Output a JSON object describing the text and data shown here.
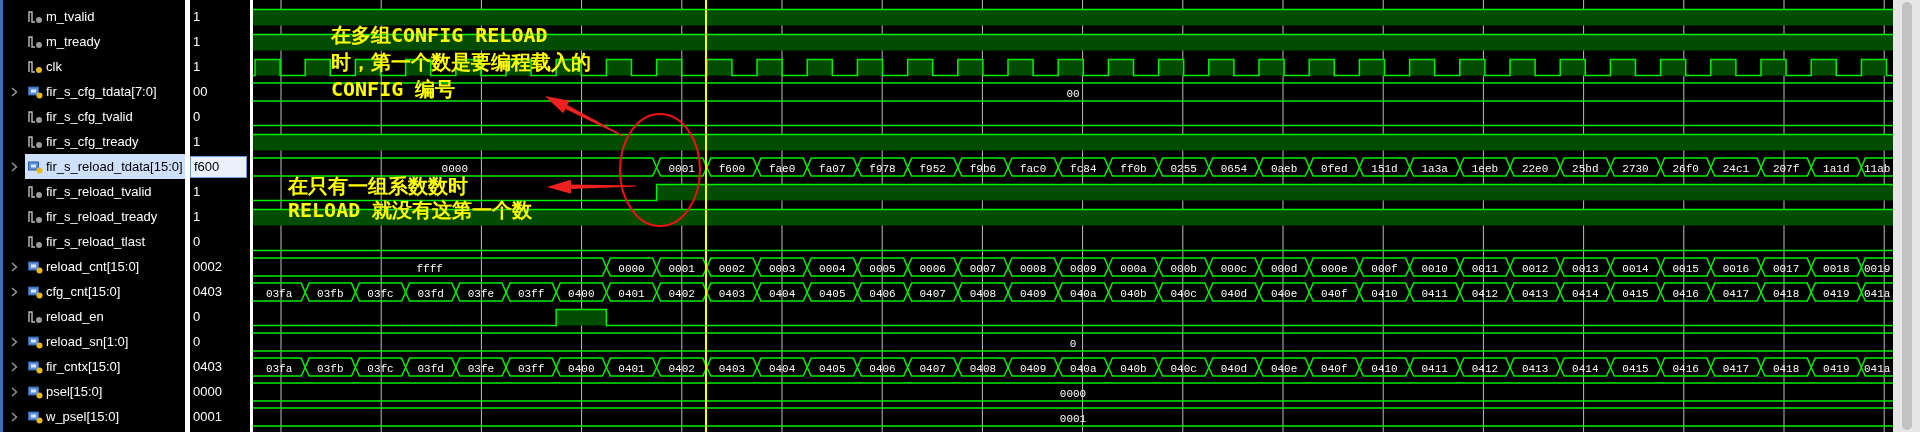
{
  "signals": [
    {
      "name": "m_tvalid",
      "value": "1",
      "kind": "bit",
      "selected": false,
      "high": [
        true
      ]
    },
    {
      "name": "m_tready",
      "value": "1",
      "kind": "bit",
      "selected": false,
      "high": [
        true
      ]
    },
    {
      "name": "clk",
      "value": "1",
      "kind": "clock",
      "selected": false
    },
    {
      "name": "fir_s_cfg_tdata[7:0]",
      "value": "00",
      "kind": "bus",
      "selected": false,
      "segments": [
        {
          "kind": "value",
          "value": "00"
        }
      ]
    },
    {
      "name": "fir_s_cfg_tvalid",
      "value": "0",
      "kind": "bit",
      "selected": false,
      "high": [
        false
      ]
    },
    {
      "name": "fir_s_cfg_tready",
      "value": "1",
      "kind": "bit",
      "selected": false,
      "high": [
        true
      ]
    },
    {
      "name": "fir_s_reload_tdata[15:0]",
      "value": "f600",
      "kind": "bus",
      "selected": true,
      "segments": [
        {
          "kind": "value",
          "value": "0000"
        },
        {
          "kind": "hold"
        },
        {
          "kind": "hold"
        },
        {
          "kind": "hold"
        },
        {
          "kind": "hold"
        },
        {
          "kind": "hold"
        },
        {
          "kind": "hold"
        },
        {
          "kind": "hold"
        },
        {
          "kind": "value",
          "value": "0001"
        },
        {
          "kind": "value",
          "value": "f600"
        },
        {
          "kind": "value",
          "value": "fae0"
        },
        {
          "kind": "value",
          "value": "fa07"
        },
        {
          "kind": "value",
          "value": "f978"
        },
        {
          "kind": "value",
          "value": "f952"
        },
        {
          "kind": "value",
          "value": "f9b6"
        },
        {
          "kind": "value",
          "value": "fac0"
        },
        {
          "kind": "value",
          "value": "fc84"
        },
        {
          "kind": "value",
          "value": "ff0b"
        },
        {
          "kind": "value",
          "value": "0255"
        },
        {
          "kind": "value",
          "value": "0654"
        },
        {
          "kind": "value",
          "value": "0aeb"
        },
        {
          "kind": "value",
          "value": "0fed"
        },
        {
          "kind": "value",
          "value": "151d"
        },
        {
          "kind": "value",
          "value": "1a3a"
        },
        {
          "kind": "value",
          "value": "1eeb"
        },
        {
          "kind": "value",
          "value": "22e0"
        },
        {
          "kind": "value",
          "value": "25bd"
        },
        {
          "kind": "value",
          "value": "2730"
        },
        {
          "kind": "value",
          "value": "26f0"
        },
        {
          "kind": "value",
          "value": "24c1"
        },
        {
          "kind": "value",
          "value": "207f"
        },
        {
          "kind": "value",
          "value": "1a1d"
        },
        {
          "kind": "value",
          "value": "11ab"
        }
      ]
    },
    {
      "name": "fir_s_reload_tvalid",
      "value": "1",
      "kind": "bit",
      "selected": false,
      "high": [
        false,
        false,
        false,
        false,
        false,
        false,
        false,
        false,
        true
      ]
    },
    {
      "name": "fir_s_reload_tready",
      "value": "1",
      "kind": "bit",
      "selected": false,
      "high": [
        true
      ]
    },
    {
      "name": "fir_s_reload_tlast",
      "value": "0",
      "kind": "bit",
      "selected": false,
      "high": [
        false
      ]
    },
    {
      "name": "reload_cnt[15:0]",
      "value": "0002",
      "kind": "bus",
      "selected": false,
      "segments": [
        {
          "kind": "value",
          "value": "ffff"
        },
        {
          "kind": "hold"
        },
        {
          "kind": "hold"
        },
        {
          "kind": "hold"
        },
        {
          "kind": "hold"
        },
        {
          "kind": "hold"
        },
        {
          "kind": "hold"
        },
        {
          "kind": "value",
          "value": "0000"
        },
        {
          "kind": "value",
          "value": "0001"
        },
        {
          "kind": "value",
          "value": "0002"
        },
        {
          "kind": "value",
          "value": "0003"
        },
        {
          "kind": "value",
          "value": "0004"
        },
        {
          "kind": "value",
          "value": "0005"
        },
        {
          "kind": "value",
          "value": "0006"
        },
        {
          "kind": "value",
          "value": "0007"
        },
        {
          "kind": "value",
          "value": "0008"
        },
        {
          "kind": "value",
          "value": "0009"
        },
        {
          "kind": "value",
          "value": "000a"
        },
        {
          "kind": "value",
          "value": "000b"
        },
        {
          "kind": "value",
          "value": "000c"
        },
        {
          "kind": "value",
          "value": "000d"
        },
        {
          "kind": "value",
          "value": "000e"
        },
        {
          "kind": "value",
          "value": "000f"
        },
        {
          "kind": "value",
          "value": "0010"
        },
        {
          "kind": "value",
          "value": "0011"
        },
        {
          "kind": "value",
          "value": "0012"
        },
        {
          "kind": "value",
          "value": "0013"
        },
        {
          "kind": "value",
          "value": "0014"
        },
        {
          "kind": "value",
          "value": "0015"
        },
        {
          "kind": "value",
          "value": "0016"
        },
        {
          "kind": "value",
          "value": "0017"
        },
        {
          "kind": "value",
          "value": "0018"
        },
        {
          "kind": "value",
          "value": "0019"
        }
      ]
    },
    {
      "name": "cfg_cnt[15:0]",
      "value": "0403",
      "kind": "bus",
      "selected": false,
      "segments": [
        {
          "kind": "value",
          "value": "03fa"
        },
        {
          "kind": "value",
          "value": "03fb"
        },
        {
          "kind": "value",
          "value": "03fc"
        },
        {
          "kind": "value",
          "value": "03fd"
        },
        {
          "kind": "value",
          "value": "03fe"
        },
        {
          "kind": "value",
          "value": "03ff"
        },
        {
          "kind": "value",
          "value": "0400"
        },
        {
          "kind": "value",
          "value": "0401"
        },
        {
          "kind": "value",
          "value": "0402"
        },
        {
          "kind": "value",
          "value": "0403"
        },
        {
          "kind": "value",
          "value": "0404"
        },
        {
          "kind": "value",
          "value": "0405"
        },
        {
          "kind": "value",
          "value": "0406"
        },
        {
          "kind": "value",
          "value": "0407"
        },
        {
          "kind": "value",
          "value": "0408"
        },
        {
          "kind": "value",
          "value": "0409"
        },
        {
          "kind": "value",
          "value": "040a"
        },
        {
          "kind": "value",
          "value": "040b"
        },
        {
          "kind": "value",
          "value": "040c"
        },
        {
          "kind": "value",
          "value": "040d"
        },
        {
          "kind": "value",
          "value": "040e"
        },
        {
          "kind": "value",
          "value": "040f"
        },
        {
          "kind": "value",
          "value": "0410"
        },
        {
          "kind": "value",
          "value": "0411"
        },
        {
          "kind": "value",
          "value": "0412"
        },
        {
          "kind": "value",
          "value": "0413"
        },
        {
          "kind": "value",
          "value": "0414"
        },
        {
          "kind": "value",
          "value": "0415"
        },
        {
          "kind": "value",
          "value": "0416"
        },
        {
          "kind": "value",
          "value": "0417"
        },
        {
          "kind": "value",
          "value": "0418"
        },
        {
          "kind": "value",
          "value": "0419"
        },
        {
          "kind": "value",
          "value": "041a"
        }
      ]
    },
    {
      "name": "reload_en",
      "value": "0",
      "kind": "bit",
      "selected": false,
      "high": [
        false,
        false,
        false,
        false,
        false,
        false,
        true,
        false
      ]
    },
    {
      "name": "reload_sn[1:0]",
      "value": "0",
      "kind": "bus",
      "selected": false,
      "segments": [
        {
          "kind": "value",
          "value": "0"
        }
      ]
    },
    {
      "name": "fir_cntx[15:0]",
      "value": "0403",
      "kind": "bus",
      "selected": false,
      "segments": [
        {
          "kind": "value",
          "value": "03fa"
        },
        {
          "kind": "value",
          "value": "03fb"
        },
        {
          "kind": "value",
          "value": "03fc"
        },
        {
          "kind": "value",
          "value": "03fd"
        },
        {
          "kind": "value",
          "value": "03fe"
        },
        {
          "kind": "value",
          "value": "03ff"
        },
        {
          "kind": "value",
          "value": "0400"
        },
        {
          "kind": "value",
          "value": "0401"
        },
        {
          "kind": "value",
          "value": "0402"
        },
        {
          "kind": "value",
          "value": "0403"
        },
        {
          "kind": "value",
          "value": "0404"
        },
        {
          "kind": "value",
          "value": "0405"
        },
        {
          "kind": "value",
          "value": "0406"
        },
        {
          "kind": "value",
          "value": "0407"
        },
        {
          "kind": "value",
          "value": "0408"
        },
        {
          "kind": "value",
          "value": "0409"
        },
        {
          "kind": "value",
          "value": "040a"
        },
        {
          "kind": "value",
          "value": "040b"
        },
        {
          "kind": "value",
          "value": "040c"
        },
        {
          "kind": "value",
          "value": "040d"
        },
        {
          "kind": "value",
          "value": "040e"
        },
        {
          "kind": "value",
          "value": "040f"
        },
        {
          "kind": "value",
          "value": "0410"
        },
        {
          "kind": "value",
          "value": "0411"
        },
        {
          "kind": "value",
          "value": "0412"
        },
        {
          "kind": "value",
          "value": "0413"
        },
        {
          "kind": "value",
          "value": "0414"
        },
        {
          "kind": "value",
          "value": "0415"
        },
        {
          "kind": "value",
          "value": "0416"
        },
        {
          "kind": "value",
          "value": "0417"
        },
        {
          "kind": "value",
          "value": "0418"
        },
        {
          "kind": "value",
          "value": "0419"
        },
        {
          "kind": "value",
          "value": "041a"
        }
      ]
    },
    {
      "name": "psel[15:0]",
      "value": "0000",
      "kind": "bus",
      "selected": false,
      "segments": [
        {
          "kind": "value",
          "value": "0000"
        }
      ]
    },
    {
      "name": "w_psel[15:0]",
      "value": "0001",
      "kind": "bus",
      "selected": false,
      "segments": [
        {
          "kind": "value",
          "value": "0001"
        }
      ]
    }
  ],
  "annotations": [
    {
      "lines": [
        "在多组CONFIG RELOAD",
        "时，第一个数是要编程载入的",
        "CONFIG 编号"
      ]
    },
    {
      "lines": [
        "在只有一组系数数时",
        "RELOAD 就没有这第一个数"
      ]
    }
  ]
}
